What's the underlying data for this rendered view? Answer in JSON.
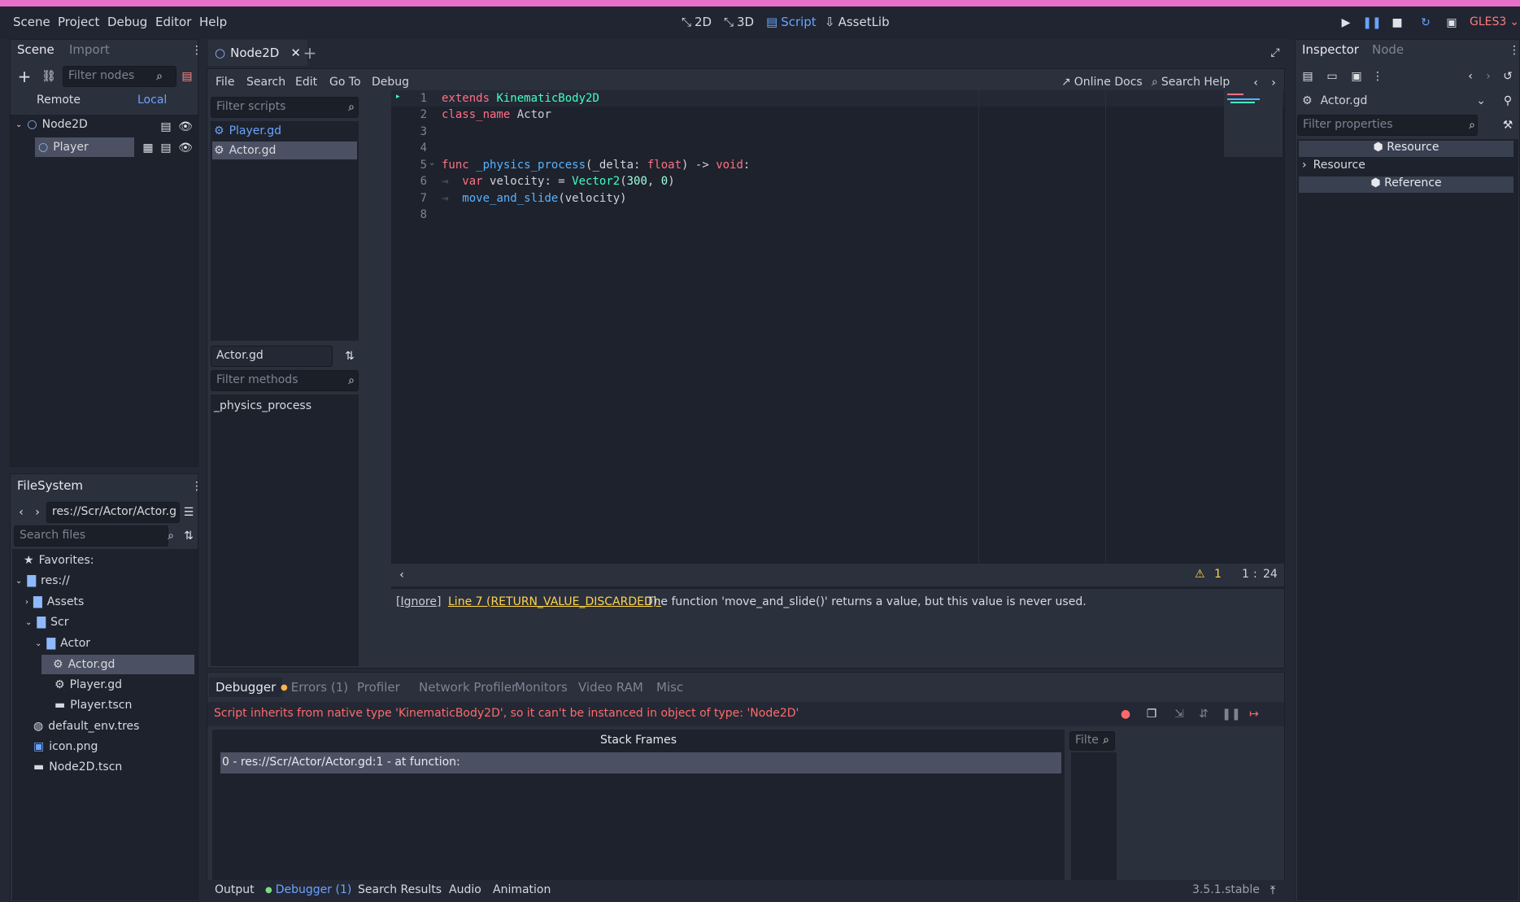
{
  "menu": [
    "Scene",
    "Project",
    "Debug",
    "Editor",
    "Help"
  ],
  "workspaces": [
    {
      "label": "2D",
      "icon": "2d-icon",
      "active": false
    },
    {
      "label": "3D",
      "icon": "3d-icon",
      "active": false
    },
    {
      "label": "Script",
      "icon": "script-icon",
      "active": true
    },
    {
      "label": "AssetLib",
      "icon": "assetlib-icon",
      "active": false
    }
  ],
  "renderer": "GLES3",
  "scene_panel": {
    "tabs": [
      "Scene",
      "Import"
    ],
    "filter_placeholder": "Filter nodes",
    "remote": "Remote",
    "local": "Local",
    "nodes": [
      "Node2D",
      "Player"
    ]
  },
  "filesystem": {
    "tab": "FileSystem",
    "path": "res://Scr/Actor/Actor.g",
    "search_placeholder": "Search files",
    "items": [
      "Favorites:",
      "res://",
      "Assets",
      "Scr",
      "Actor",
      "Actor.gd",
      "Player.gd",
      "Player.tscn",
      "default_env.tres",
      "icon.png",
      "Node2D.tscn"
    ]
  },
  "editor_tab": {
    "label": "Node2D"
  },
  "script_menu": [
    "File",
    "Search",
    "Edit",
    "Go To",
    "Debug"
  ],
  "script_toolbar": {
    "online_docs": "Online Docs",
    "search_help": "Search Help"
  },
  "scripts_list": {
    "filter_placeholder": "Filter scripts",
    "items": [
      "Player.gd",
      "Actor.gd"
    ],
    "current": "Actor.gd",
    "methods_placeholder": "Filter methods",
    "methods": [
      "_physics_process"
    ]
  },
  "code": {
    "lines": [
      "1",
      "2",
      "3",
      "4",
      "5",
      "6",
      "7",
      "8"
    ]
  },
  "status": {
    "warning_count": "1",
    "line": "1",
    "col": "24"
  },
  "warning": {
    "ignore": "[Ignore]",
    "link": "Line 7 (RETURN_VALUE_DISCARDED):",
    "message": "The function 'move_and_slide()' returns a value, but this value is never used."
  },
  "debugger": {
    "tabs": [
      "Debugger",
      "Errors (1)",
      "Profiler",
      "Network Profiler",
      "Monitors",
      "Video RAM",
      "Misc"
    ],
    "error": "Script inherits from native type 'KinematicBody2D', so it can't be instanced in object of type: 'Node2D'",
    "stack_header": "Stack Frames",
    "stack_frame": "0 - res://Scr/Actor/Actor.gd:1 - at function:",
    "filter_placeholder": "Filte"
  },
  "bottom_tabs": [
    "Output",
    "Debugger (1)",
    "Search Results",
    "Audio",
    "Animation"
  ],
  "version": "3.5.1.stable",
  "inspector": {
    "tabs": [
      "Inspector",
      "Node"
    ],
    "object": "Actor.gd",
    "filter_placeholder": "Filter properties",
    "sections": [
      "Resource",
      "Resource",
      "Reference"
    ]
  }
}
